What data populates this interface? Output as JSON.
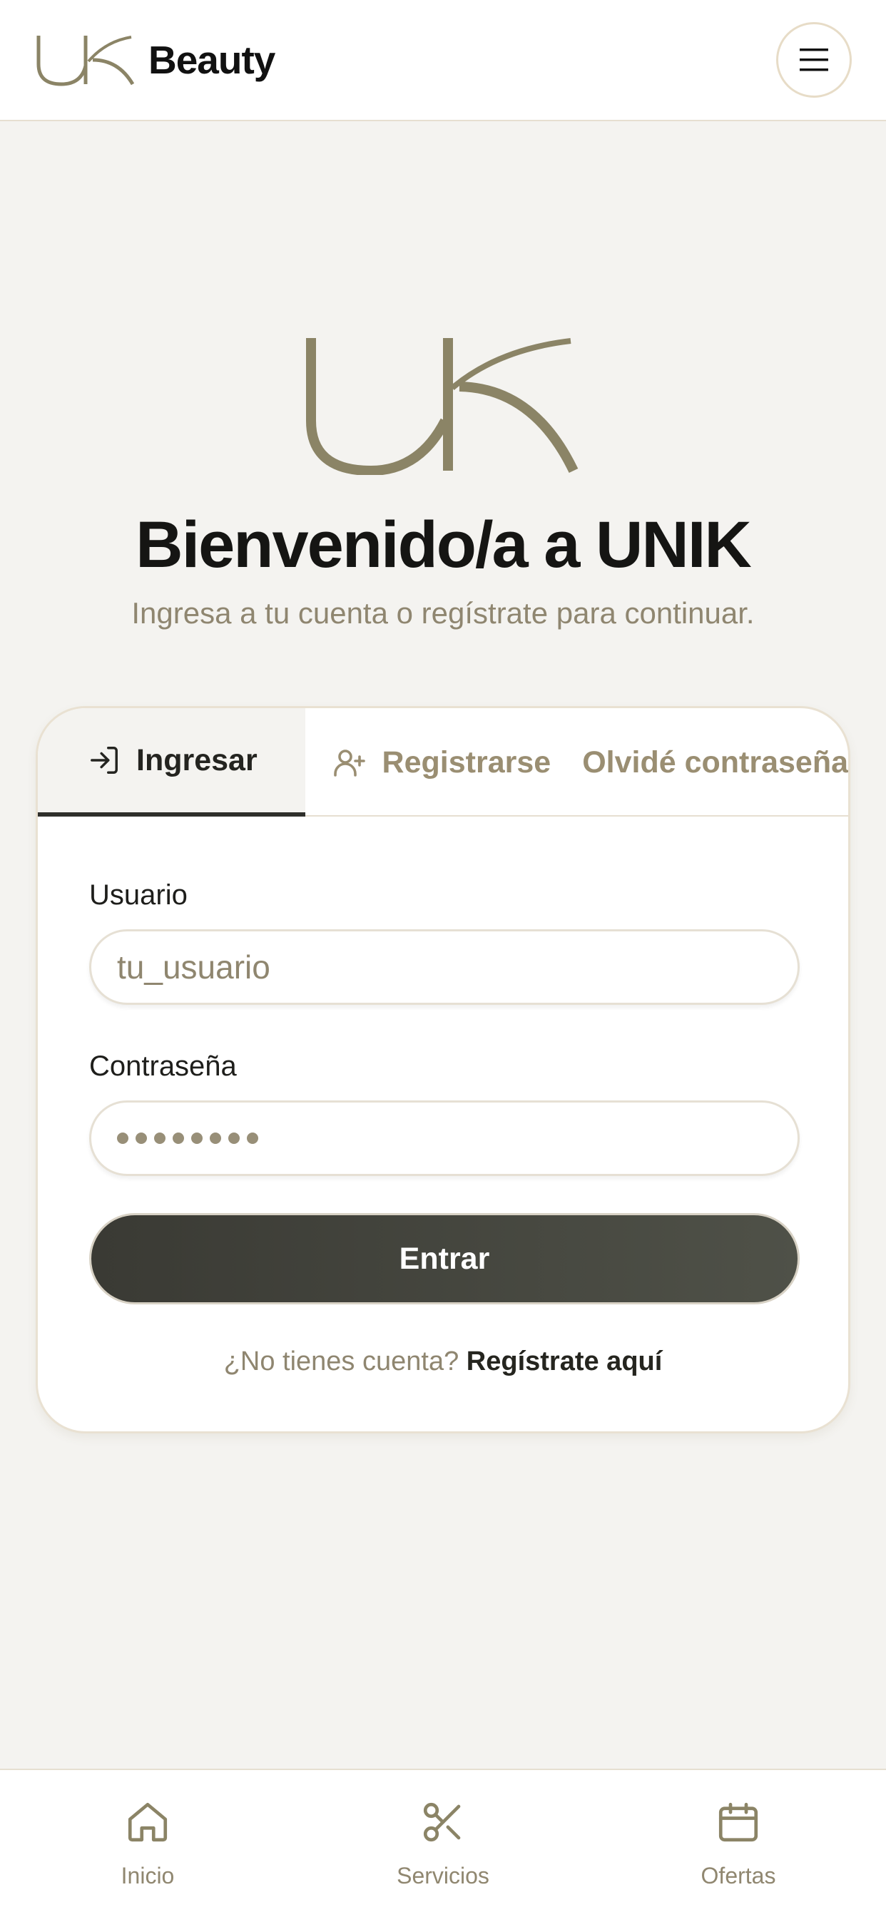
{
  "header": {
    "brand_name": "Beauty",
    "logo_icon": "uk-monogram-icon",
    "menu_icon": "hamburger-menu-icon"
  },
  "hero": {
    "title": "Bienvenido/a a UNIK",
    "subtitle": "Ingresa a tu cuenta o regístrate para continuar."
  },
  "tabs": [
    {
      "label": "Ingresar",
      "icon": "login-icon",
      "active": true
    },
    {
      "label": "Registrarse",
      "icon": "user-plus-icon",
      "active": false
    },
    {
      "label": "Olvidé contraseña",
      "active": false
    }
  ],
  "form": {
    "username_label": "Usuario",
    "username_placeholder": "tu_usuario",
    "password_label": "Contraseña",
    "password_masked_length": 8,
    "submit_label": "Entrar",
    "no_account_text": "¿No tienes cuenta?",
    "register_link": "Regístrate aquí"
  },
  "bottom_nav": [
    {
      "label": "Inicio",
      "icon": "home-icon"
    },
    {
      "label": "Servicios",
      "icon": "scissors-icon"
    },
    {
      "label": "Ofertas",
      "icon": "calendar-icon"
    }
  ],
  "colors": {
    "accent": "#8b8466",
    "dark_button": "#3f403a",
    "background": "#f4f3f0",
    "muted_text": "#8f8670"
  }
}
